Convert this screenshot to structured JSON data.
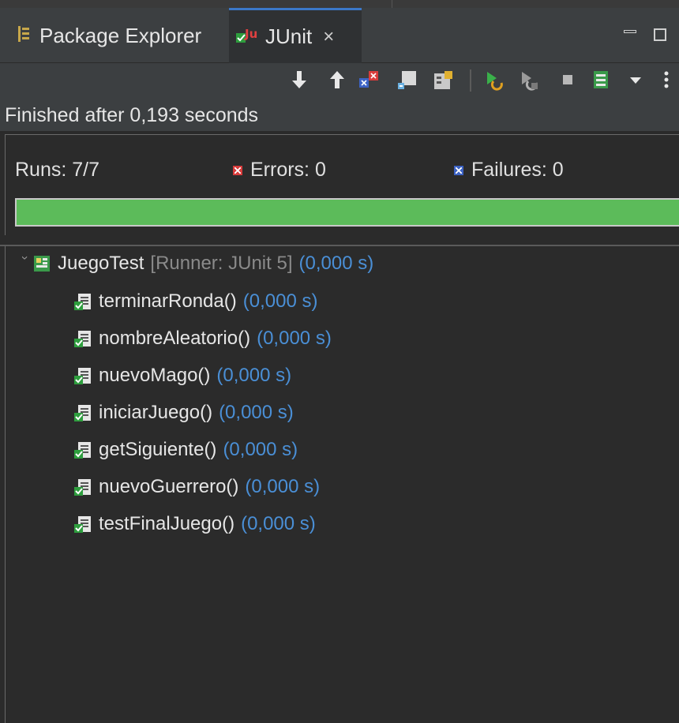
{
  "tabs": [
    {
      "label": "Package Explorer",
      "icon": "package-explorer-icon",
      "active": false
    },
    {
      "label": "JUnit",
      "icon": "junit-icon",
      "active": true,
      "close_glyph": "×"
    }
  ],
  "toolbar": {
    "icons": [
      "next-failure-icon",
      "previous-failure-icon",
      "show-failures-only-icon",
      "scroll-lock-icon",
      "show-skipped-icon",
      "rerun-test-icon",
      "rerun-failed-first-icon",
      "stop-icon",
      "test-run-history-icon",
      "view-menu-icon",
      "more-icon"
    ]
  },
  "status": {
    "text": "Finished after 0,193 seconds"
  },
  "counters": {
    "runs": "Runs:  7/7",
    "errors": "Errors:  0",
    "failures": "Failures:  0"
  },
  "progress": {
    "fraction": 1.0,
    "color": "#5cbb5a"
  },
  "tree": {
    "suite": {
      "name": "JuegoTest",
      "runner": "[Runner: JUnit 5]",
      "time": "(0,000 s)"
    },
    "tests": [
      {
        "name": "terminarRonda()",
        "time": "(0,000 s)"
      },
      {
        "name": "nombreAleatorio()",
        "time": "(0,000 s)"
      },
      {
        "name": "nuevoMago()",
        "time": "(0,000 s)"
      },
      {
        "name": "iniciarJuego()",
        "time": "(0,000 s)"
      },
      {
        "name": "getSiguiente()",
        "time": "(0,000 s)"
      },
      {
        "name": "nuevoGuerrero()",
        "time": "(0,000 s)"
      },
      {
        "name": "testFinalJuego()",
        "time": "(0,000 s)"
      }
    ]
  },
  "colors": {
    "accent": "#3b78c8",
    "pass": "#5cbb5a",
    "error": "#d83c3c",
    "failure": "#3d63c4",
    "time": "#4a8fd6"
  }
}
